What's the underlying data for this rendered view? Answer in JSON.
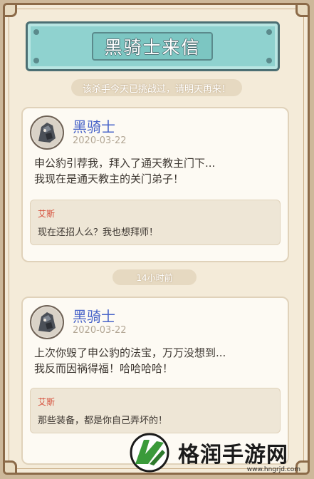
{
  "title": "黑骑士来信",
  "notice": "该杀手今天已挑战过，请明天再来！",
  "time_divider": "14小时前",
  "messages": [
    {
      "sender": "黑骑士",
      "date": "2020-03-22",
      "lines": [
        "申公豹引荐我，拜入了通天教主门下...",
        "我现在是通天教主的关门弟子！"
      ],
      "reply": {
        "name": "艾斯",
        "text": "现在还招人么？我也想拜师！"
      }
    },
    {
      "sender": "黑骑士",
      "date": "2020-03-22",
      "lines": [
        "上次你毁了申公豹的法宝，万万没想到...",
        "我反而因祸得福！哈哈哈哈！"
      ],
      "reply": {
        "name": "艾斯",
        "text": "那些装备，都是你自己弄坏的！"
      }
    }
  ],
  "watermark": {
    "text": "格润手游网",
    "url": "www.hngrjd.com"
  },
  "colors": {
    "sender": "#4a65c9",
    "reply_name": "#d54f3b",
    "banner": "#8fd2cf",
    "logo_green": "#3a9a3a"
  }
}
